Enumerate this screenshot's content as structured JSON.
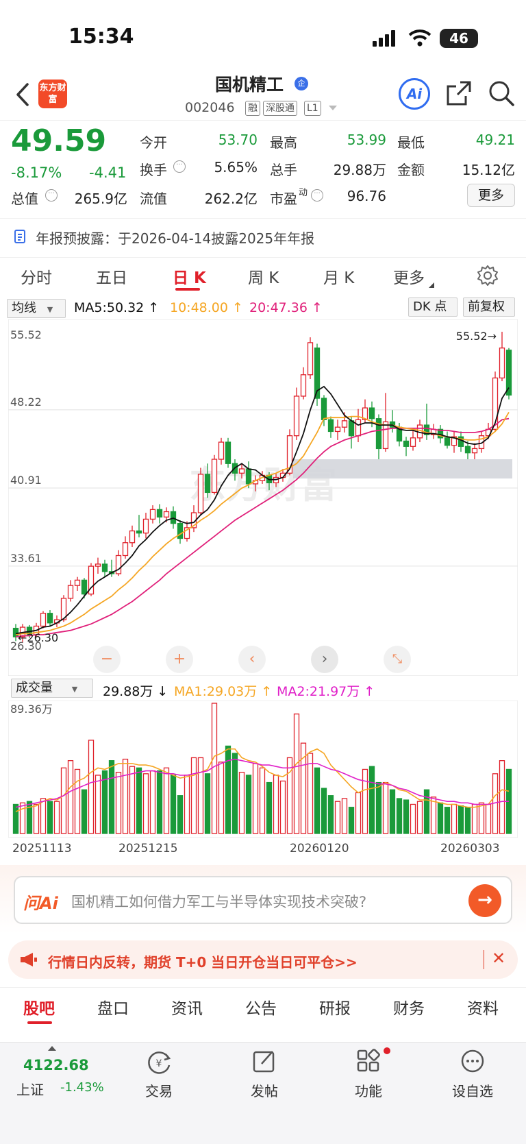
{
  "status": {
    "time": "15:34",
    "battery": "46"
  },
  "header": {
    "logo_text": "东方财富",
    "name": "国机精工",
    "badge": "企",
    "code": "002046",
    "tags": [
      "融",
      "深股通",
      "L1"
    ],
    "ai_label": "Ai"
  },
  "quote": {
    "price": "49.59",
    "change_pct": "-8.17%",
    "change": "-4.41",
    "open_label": "今开",
    "open": "53.70",
    "high_label": "最高",
    "high": "53.99",
    "low_label": "最低",
    "low": "49.21",
    "turnover_label": "换手",
    "turnover": "5.65%",
    "volume_label": "总手",
    "volume": "29.88万",
    "amount_label": "金额",
    "amount": "15.12亿",
    "mcap_label": "总值",
    "mcap": "265.9亿",
    "float_label": "流值",
    "float": "262.2亿",
    "pe_label": "市盈",
    "pe_sup": "动",
    "pe": "96.76",
    "more_label": "更多"
  },
  "notice": {
    "text": "年报预披露：于2026-04-14披露2025年年报"
  },
  "chart_tabs": [
    "分时",
    "五日",
    "日 K",
    "周 K",
    "月 K",
    "更多"
  ],
  "active_chart_tab": "日 K",
  "ma_bar": {
    "select": "均线",
    "ma5": "MA5:50.32 ↑",
    "ma10": "10:48.00 ↑",
    "ma20": "20:47.36 ↑",
    "dk": "DK 点",
    "fq": "前复权"
  },
  "vol_bar": {
    "select": "成交量",
    "vol": "29.88万 ↓",
    "ma1": "MA1:29.03万 ↑",
    "ma2": "MA2:21.97万 ↑"
  },
  "chart_data": {
    "type": "candlestick",
    "y_ticks": [
      "55.52",
      "48.22",
      "40.91",
      "33.61",
      "26.30"
    ],
    "ylim": [
      26.3,
      55.52
    ],
    "max_marker": "55.52→",
    "min_marker": "26.30",
    "x_ticks": [
      "20251113",
      "20251215",
      "20260120",
      "20260303"
    ],
    "volume_max_label": "89.36万",
    "candles": [
      {
        "o": 27.8,
        "c": 27.0,
        "h": 28.2,
        "l": 26.6
      },
      {
        "o": 27.0,
        "c": 27.9,
        "h": 28.2,
        "l": 26.5
      },
      {
        "o": 27.9,
        "c": 27.2,
        "h": 28.1,
        "l": 26.9
      },
      {
        "o": 27.2,
        "c": 28.0,
        "h": 28.3,
        "l": 27.0
      },
      {
        "o": 28.0,
        "c": 29.2,
        "h": 29.4,
        "l": 27.8
      },
      {
        "o": 29.2,
        "c": 28.3,
        "h": 29.5,
        "l": 28.0
      },
      {
        "o": 28.3,
        "c": 28.6,
        "h": 29.0,
        "l": 27.9
      },
      {
        "o": 28.6,
        "c": 30.6,
        "h": 30.9,
        "l": 28.4
      },
      {
        "o": 30.6,
        "c": 31.8,
        "h": 32.3,
        "l": 30.3
      },
      {
        "o": 31.8,
        "c": 32.3,
        "h": 32.6,
        "l": 31.3
      },
      {
        "o": 32.3,
        "c": 31.0,
        "h": 32.5,
        "l": 30.6
      },
      {
        "o": 31.0,
        "c": 33.6,
        "h": 33.9,
        "l": 30.8
      },
      {
        "o": 33.6,
        "c": 33.8,
        "h": 34.4,
        "l": 32.9
      },
      {
        "o": 33.8,
        "c": 33.1,
        "h": 34.2,
        "l": 32.6
      },
      {
        "o": 33.1,
        "c": 32.9,
        "h": 34.2,
        "l": 32.6
      },
      {
        "o": 32.9,
        "c": 34.6,
        "h": 35.1,
        "l": 32.7
      },
      {
        "o": 34.6,
        "c": 35.8,
        "h": 36.4,
        "l": 34.3
      },
      {
        "o": 35.8,
        "c": 36.9,
        "h": 37.4,
        "l": 35.4
      },
      {
        "o": 36.9,
        "c": 36.7,
        "h": 38.4,
        "l": 36.3
      },
      {
        "o": 36.7,
        "c": 38.0,
        "h": 38.6,
        "l": 36.2
      },
      {
        "o": 38.0,
        "c": 38.9,
        "h": 39.3,
        "l": 37.6
      },
      {
        "o": 38.9,
        "c": 38.2,
        "h": 39.4,
        "l": 37.6
      },
      {
        "o": 38.2,
        "c": 38.7,
        "h": 39.1,
        "l": 37.7
      },
      {
        "o": 38.7,
        "c": 37.6,
        "h": 39.2,
        "l": 37.1
      },
      {
        "o": 37.6,
        "c": 36.2,
        "h": 37.9,
        "l": 35.7
      },
      {
        "o": 36.2,
        "c": 37.2,
        "h": 37.8,
        "l": 35.9
      },
      {
        "o": 37.2,
        "c": 38.6,
        "h": 39.3,
        "l": 36.8
      },
      {
        "o": 38.6,
        "c": 42.2,
        "h": 42.8,
        "l": 38.4
      },
      {
        "o": 42.2,
        "c": 40.5,
        "h": 43.2,
        "l": 40.0
      },
      {
        "o": 40.5,
        "c": 43.6,
        "h": 44.0,
        "l": 40.3
      },
      {
        "o": 43.6,
        "c": 45.2,
        "h": 45.6,
        "l": 43.1
      },
      {
        "o": 45.2,
        "c": 43.2,
        "h": 45.6,
        "l": 42.8
      },
      {
        "o": 43.2,
        "c": 42.3,
        "h": 43.6,
        "l": 41.6
      },
      {
        "o": 42.3,
        "c": 42.7,
        "h": 43.2,
        "l": 41.8
      },
      {
        "o": 42.7,
        "c": 41.3,
        "h": 43.4,
        "l": 40.9
      },
      {
        "o": 41.3,
        "c": 41.6,
        "h": 42.1,
        "l": 40.6
      },
      {
        "o": 41.6,
        "c": 42.1,
        "h": 42.5,
        "l": 41.3
      },
      {
        "o": 42.1,
        "c": 41.4,
        "h": 42.4,
        "l": 40.7
      },
      {
        "o": 41.4,
        "c": 41.9,
        "h": 42.3,
        "l": 41.0
      },
      {
        "o": 41.9,
        "c": 42.3,
        "h": 42.7,
        "l": 41.5
      },
      {
        "o": 42.3,
        "c": 45.8,
        "h": 46.4,
        "l": 42.1
      },
      {
        "o": 45.8,
        "c": 49.5,
        "h": 50.3,
        "l": 45.4
      },
      {
        "o": 49.5,
        "c": 51.5,
        "h": 52.2,
        "l": 49.2
      },
      {
        "o": 51.5,
        "c": 54.5,
        "h": 55.0,
        "l": 51.1
      },
      {
        "o": 54.0,
        "c": 49.3,
        "h": 54.4,
        "l": 48.6
      },
      {
        "o": 49.3,
        "c": 47.3,
        "h": 49.6,
        "l": 46.7
      },
      {
        "o": 47.3,
        "c": 46.2,
        "h": 47.6,
        "l": 45.6
      },
      {
        "o": 46.2,
        "c": 46.6,
        "h": 47.3,
        "l": 45.4
      },
      {
        "o": 46.6,
        "c": 47.2,
        "h": 48.0,
        "l": 46.1
      },
      {
        "o": 47.2,
        "c": 45.8,
        "h": 47.6,
        "l": 44.6
      },
      {
        "o": 45.8,
        "c": 47.3,
        "h": 48.3,
        "l": 45.2
      },
      {
        "o": 47.3,
        "c": 48.4,
        "h": 49.2,
        "l": 47.0
      },
      {
        "o": 48.4,
        "c": 47.4,
        "h": 49.0,
        "l": 46.6
      },
      {
        "o": 47.4,
        "c": 44.6,
        "h": 47.8,
        "l": 43.6
      },
      {
        "o": 44.6,
        "c": 47.1,
        "h": 49.8,
        "l": 44.3
      },
      {
        "o": 47.1,
        "c": 46.6,
        "h": 48.2,
        "l": 46.1
      },
      {
        "o": 46.6,
        "c": 45.3,
        "h": 47.0,
        "l": 44.8
      },
      {
        "o": 45.3,
        "c": 44.8,
        "h": 45.7,
        "l": 43.9
      },
      {
        "o": 44.8,
        "c": 45.6,
        "h": 46.3,
        "l": 44.4
      },
      {
        "o": 45.6,
        "c": 46.8,
        "h": 47.3,
        "l": 45.2
      },
      {
        "o": 46.8,
        "c": 45.9,
        "h": 48.8,
        "l": 45.4
      },
      {
        "o": 45.9,
        "c": 46.4,
        "h": 46.9,
        "l": 45.5
      },
      {
        "o": 46.4,
        "c": 45.6,
        "h": 46.8,
        "l": 45.1
      },
      {
        "o": 45.6,
        "c": 44.9,
        "h": 46.2,
        "l": 44.6
      },
      {
        "o": 44.9,
        "c": 45.7,
        "h": 46.2,
        "l": 44.2
      },
      {
        "o": 45.7,
        "c": 44.8,
        "h": 46.2,
        "l": 44.3
      },
      {
        "o": 44.8,
        "c": 44.2,
        "h": 45.3,
        "l": 43.6
      },
      {
        "o": 44.2,
        "c": 44.6,
        "h": 45.1,
        "l": 43.6
      },
      {
        "o": 44.6,
        "c": 45.8,
        "h": 46.2,
        "l": 44.2
      },
      {
        "o": 45.8,
        "c": 46.4,
        "h": 47.0,
        "l": 45.5
      },
      {
        "o": 46.4,
        "c": 51.2,
        "h": 51.8,
        "l": 46.2
      },
      {
        "o": 51.2,
        "c": 54.0,
        "h": 55.52,
        "l": 50.9
      },
      {
        "o": 53.8,
        "c": 49.6,
        "h": 54.0,
        "l": 49.2
      }
    ],
    "ma5": [
      27.3,
      27.4,
      27.5,
      27.6,
      27.9,
      28.0,
      28.3,
      28.7,
      29.3,
      30.0,
      30.8,
      31.6,
      32.2,
      32.6,
      33.0,
      33.3,
      33.9,
      34.6,
      35.5,
      36.1,
      36.8,
      37.4,
      37.9,
      38.1,
      37.8,
      37.6,
      37.7,
      38.4,
      38.9,
      39.8,
      41.1,
      42.1,
      42.8,
      43.2,
      42.7,
      42.6,
      42.1,
      41.7,
      41.7,
      41.9,
      42.7,
      44.3,
      46.0,
      48.2,
      50.0,
      50.4,
      49.7,
      48.7,
      47.7,
      47.2,
      46.8,
      47.0,
      47.0,
      46.8,
      46.8,
      46.8,
      46.4,
      46.3,
      46.3,
      46.1,
      46.0,
      46.0,
      45.9,
      45.7,
      45.6,
      45.4,
      45.1,
      45.0,
      45.1,
      45.6,
      47.0,
      49.3,
      50.3
    ],
    "ma10": [
      27.2,
      27.3,
      27.3,
      27.4,
      27.5,
      27.6,
      27.8,
      28.0,
      28.3,
      28.7,
      29.1,
      29.6,
      30.0,
      30.4,
      30.8,
      31.4,
      31.9,
      32.5,
      33.2,
      33.8,
      34.5,
      35.1,
      35.7,
      36.2,
      36.6,
      37.0,
      37.4,
      37.9,
      38.3,
      38.8,
      39.4,
      39.9,
      40.4,
      40.9,
      41.2,
      41.6,
      41.9,
      42.1,
      42.3,
      42.6,
      42.8,
      43.2,
      43.9,
      45.0,
      46.1,
      47.4,
      47.5,
      47.5,
      47.5,
      47.6,
      47.6,
      47.4,
      47.1,
      46.9,
      46.8,
      46.8,
      46.6,
      46.5,
      46.4,
      46.3,
      46.1,
      46.0,
      45.8,
      45.7,
      45.6,
      45.5,
      45.4,
      45.4,
      45.5,
      45.7,
      46.2,
      46.9,
      48.0
    ],
    "ma20": [
      27.0,
      27.1,
      27.1,
      27.2,
      27.2,
      27.3,
      27.4,
      27.5,
      27.6,
      27.8,
      28.0,
      28.2,
      28.5,
      28.8,
      29.1,
      29.5,
      29.9,
      30.3,
      30.8,
      31.3,
      31.8,
      32.3,
      32.9,
      33.4,
      33.9,
      34.4,
      34.9,
      35.4,
      35.9,
      36.4,
      36.9,
      37.4,
      37.9,
      38.3,
      38.7,
      39.1,
      39.5,
      39.9,
      40.3,
      40.7,
      41.2,
      41.7,
      42.3,
      43.0,
      43.7,
      44.3,
      44.8,
      45.1,
      45.4,
      45.6,
      45.8,
      46.0,
      46.2,
      46.3,
      46.4,
      46.5,
      46.5,
      46.5,
      46.5,
      46.5,
      46.5,
      46.4,
      46.3,
      46.3,
      46.2,
      46.1,
      46.1,
      46.1,
      46.2,
      46.4,
      46.8,
      47.3,
      47.4
    ],
    "volumes": [
      20,
      21,
      22,
      20,
      24,
      22,
      22,
      45,
      50,
      44,
      30,
      64,
      40,
      43,
      50,
      42,
      51,
      46,
      45,
      41,
      43,
      43,
      45,
      40,
      26,
      40,
      52,
      52,
      41,
      89.36,
      49,
      60,
      55,
      42,
      40,
      48,
      45,
      35,
      40,
      36,
      52,
      82,
      62,
      55,
      45,
      31,
      26,
      22,
      24,
      18,
      28,
      44,
      46,
      35,
      35,
      30,
      24,
      23,
      20,
      22,
      30,
      25,
      21,
      18,
      20,
      19,
      18,
      20,
      21,
      20,
      41,
      50,
      44
    ],
    "vol_ma1": [
      15,
      17,
      18,
      19,
      22,
      24,
      23,
      26,
      32,
      36,
      38,
      42,
      45,
      44,
      46,
      48,
      48,
      48,
      47,
      47,
      46,
      44,
      42,
      40,
      38,
      39,
      40,
      42,
      44,
      53,
      55,
      58,
      58,
      52,
      50,
      49,
      46,
      42,
      40,
      39,
      42,
      48,
      52,
      56,
      58,
      55,
      47,
      42,
      37,
      32,
      28,
      30,
      31,
      32,
      35,
      33,
      30,
      29,
      26,
      23,
      23,
      22,
      21,
      20,
      20,
      19,
      18,
      18,
      19,
      20,
      26,
      30,
      29
    ],
    "vol_ma2": [
      18,
      19,
      20,
      21,
      22,
      23,
      24,
      26,
      29,
      31,
      33,
      35,
      36,
      37,
      38,
      39,
      40,
      41,
      42,
      43,
      43,
      42,
      41,
      41,
      40,
      40,
      41,
      42,
      43,
      46,
      48,
      50,
      51,
      50,
      49,
      48,
      47,
      47,
      46,
      45,
      45,
      46,
      47,
      48,
      48,
      46,
      44,
      43,
      41,
      39,
      37,
      36,
      35,
      34,
      34,
      33,
      31,
      30,
      28,
      26,
      25,
      24,
      23,
      22,
      22,
      21,
      21,
      20,
      20,
      20,
      21,
      22,
      22
    ]
  },
  "ask": {
    "brand": "问Ai",
    "question": "国机精工如何借力军工与半导体实现技术突破?"
  },
  "promo": {
    "text": "行情日内反转，期货 T+0 当日开仓当日可平仓>>"
  },
  "section_tabs": [
    "股吧",
    "盘口",
    "资讯",
    "公告",
    "研报",
    "财务",
    "资料"
  ],
  "active_section_tab": "股吧",
  "bottombar": {
    "index_value": "4122.68",
    "index_name": "上证",
    "index_change": "-1.43%",
    "items": [
      "交易",
      "发帖",
      "功能",
      "设自选"
    ]
  },
  "colors": {
    "up": "#e0202a",
    "down": "#1a9a3a",
    "ma5": "#111111",
    "ma10": "#f5a623",
    "ma20": "#e0207a",
    "accent": "#2f6cf0"
  },
  "watermark": "东方财富"
}
